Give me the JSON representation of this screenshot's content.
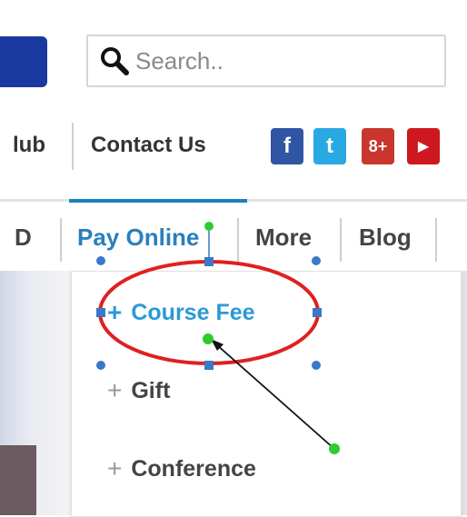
{
  "search": {
    "placeholder": "Search.."
  },
  "nav_top": {
    "hub_label": "lub",
    "contact_label": "Contact Us"
  },
  "social": [
    {
      "name": "facebook",
      "glyph": "f",
      "color": "#2f55a4"
    },
    {
      "name": "twitter",
      "glyph": "t",
      "color": "#29a9e1"
    },
    {
      "name": "google-plus",
      "glyph": "8+",
      "color": "#c9372c"
    },
    {
      "name": "youtube",
      "glyph": "▶",
      "color": "#cc181e"
    }
  ],
  "nav_main": {
    "partial_label": "D",
    "pay_online_label": "Pay Online",
    "more_label": "More",
    "blog_label": "Blog"
  },
  "dropdown": {
    "plus_glyph": "+",
    "items": [
      {
        "label": "Course Fee"
      },
      {
        "label": "Gift"
      },
      {
        "label": "Conference"
      }
    ]
  },
  "annotation": {
    "ellipse_color": "#e02020",
    "handle_color": "#3a78c8",
    "arrow_color": "#111111",
    "dot_color": "#2ecc2e"
  }
}
